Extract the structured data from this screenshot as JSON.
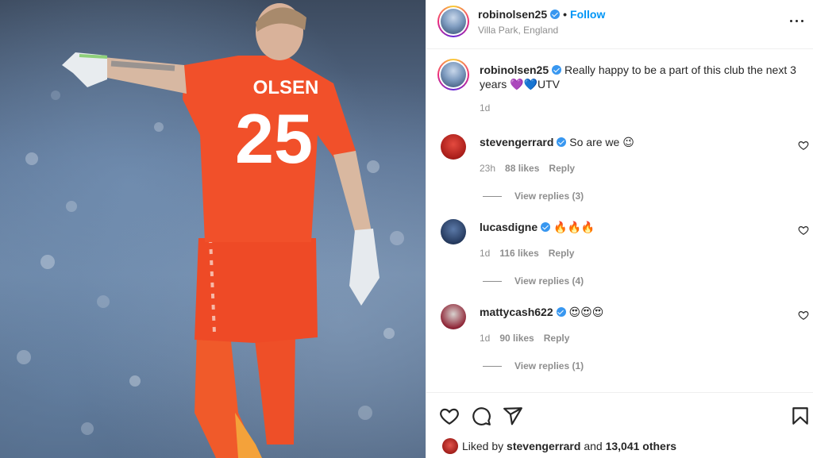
{
  "post": {
    "username": "robinolsen25",
    "location": "Villa Park, England",
    "follow_label": "Follow",
    "dot": "•",
    "caption_username": "robinolsen25",
    "caption_text": "Really happy to be a part of this club the next 3 years",
    "caption_hearts": [
      "💜",
      "💙"
    ],
    "caption_suffix": "UTV",
    "caption_time": "1d",
    "jersey_name": "OLSEN",
    "jersey_number": "25",
    "likes_avatar_user": "stevengerrard",
    "liked_by_prefix": "Liked by",
    "liked_by_user": "stevengerrard",
    "liked_by_and": "and",
    "liked_by_count": "13,041 others"
  },
  "comments": [
    {
      "username": "stevengerrard",
      "text": "So are we",
      "emoji": "😉",
      "time": "23h",
      "likes": "88 likes",
      "reply": "Reply",
      "view_replies": "View replies (3)",
      "avatar_color": "#c02a23"
    },
    {
      "username": "lucasdigne",
      "text": "",
      "emoji": "🔥🔥🔥",
      "time": "1d",
      "likes": "116 likes",
      "reply": "Reply",
      "view_replies": "View replies (4)",
      "avatar_color": "#253a5e"
    },
    {
      "username": "mattycash622",
      "text": "",
      "emoji": "😍😍😍",
      "time": "1d",
      "likes": "90 likes",
      "reply": "Reply",
      "view_replies": "View replies (1)",
      "avatar_color": "#8f2637"
    }
  ],
  "icons": {
    "more": "more-options-icon",
    "like": "heart-icon",
    "comment": "comment-icon",
    "share": "share-icon",
    "save": "bookmark-icon"
  },
  "colors": {
    "link_blue": "#0095f6",
    "verified_blue": "#3897f0",
    "muted": "#8e8e8e",
    "text": "#262626",
    "kit_orange": "#f0502a"
  }
}
